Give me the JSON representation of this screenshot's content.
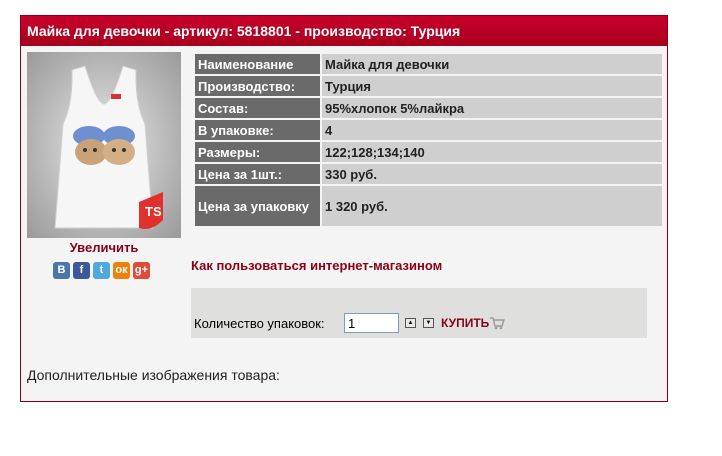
{
  "title": "Майка для девочки - артикул: 5818801 - производство: Турция",
  "image": {
    "alt_icon": "tank-top-product-photo",
    "brand_mark": "TS"
  },
  "enlarge_label": "Увеличить",
  "share": [
    {
      "icon": "vk-icon",
      "glyph": "В",
      "color": "#4a76a8"
    },
    {
      "icon": "facebook-icon",
      "glyph": "f",
      "color": "#3b5998"
    },
    {
      "icon": "twitter-icon",
      "glyph": "t",
      "color": "#4ea9dd"
    },
    {
      "icon": "odnoklassniki-icon",
      "glyph": "ок",
      "color": "#ee8208"
    },
    {
      "icon": "google-plus-icon",
      "glyph": "g+",
      "color": "#dd4b39"
    }
  ],
  "specs": [
    {
      "key": "Наименование",
      "value": "Майка для девочки"
    },
    {
      "key": "Производство:",
      "value": "Турция"
    },
    {
      "key": "Состав:",
      "value": "95%хлопок 5%лайкра"
    },
    {
      "key": "В упаковке:",
      "value": "4"
    },
    {
      "key": "Размеры:",
      "value": "122;128;134;140"
    },
    {
      "key": "Цена за 1шт.:",
      "value": "330 руб."
    },
    {
      "key": "Цена за упаковку",
      "value": "1 320 руб."
    }
  ],
  "howto_link": "Как пользоваться интернет-магазином",
  "order": {
    "qty_label": "Количество упаковок:",
    "qty_value": "1",
    "buy_label": "КУПИТЬ"
  },
  "extra_images_label": "Дополнительные изображения товара:"
}
